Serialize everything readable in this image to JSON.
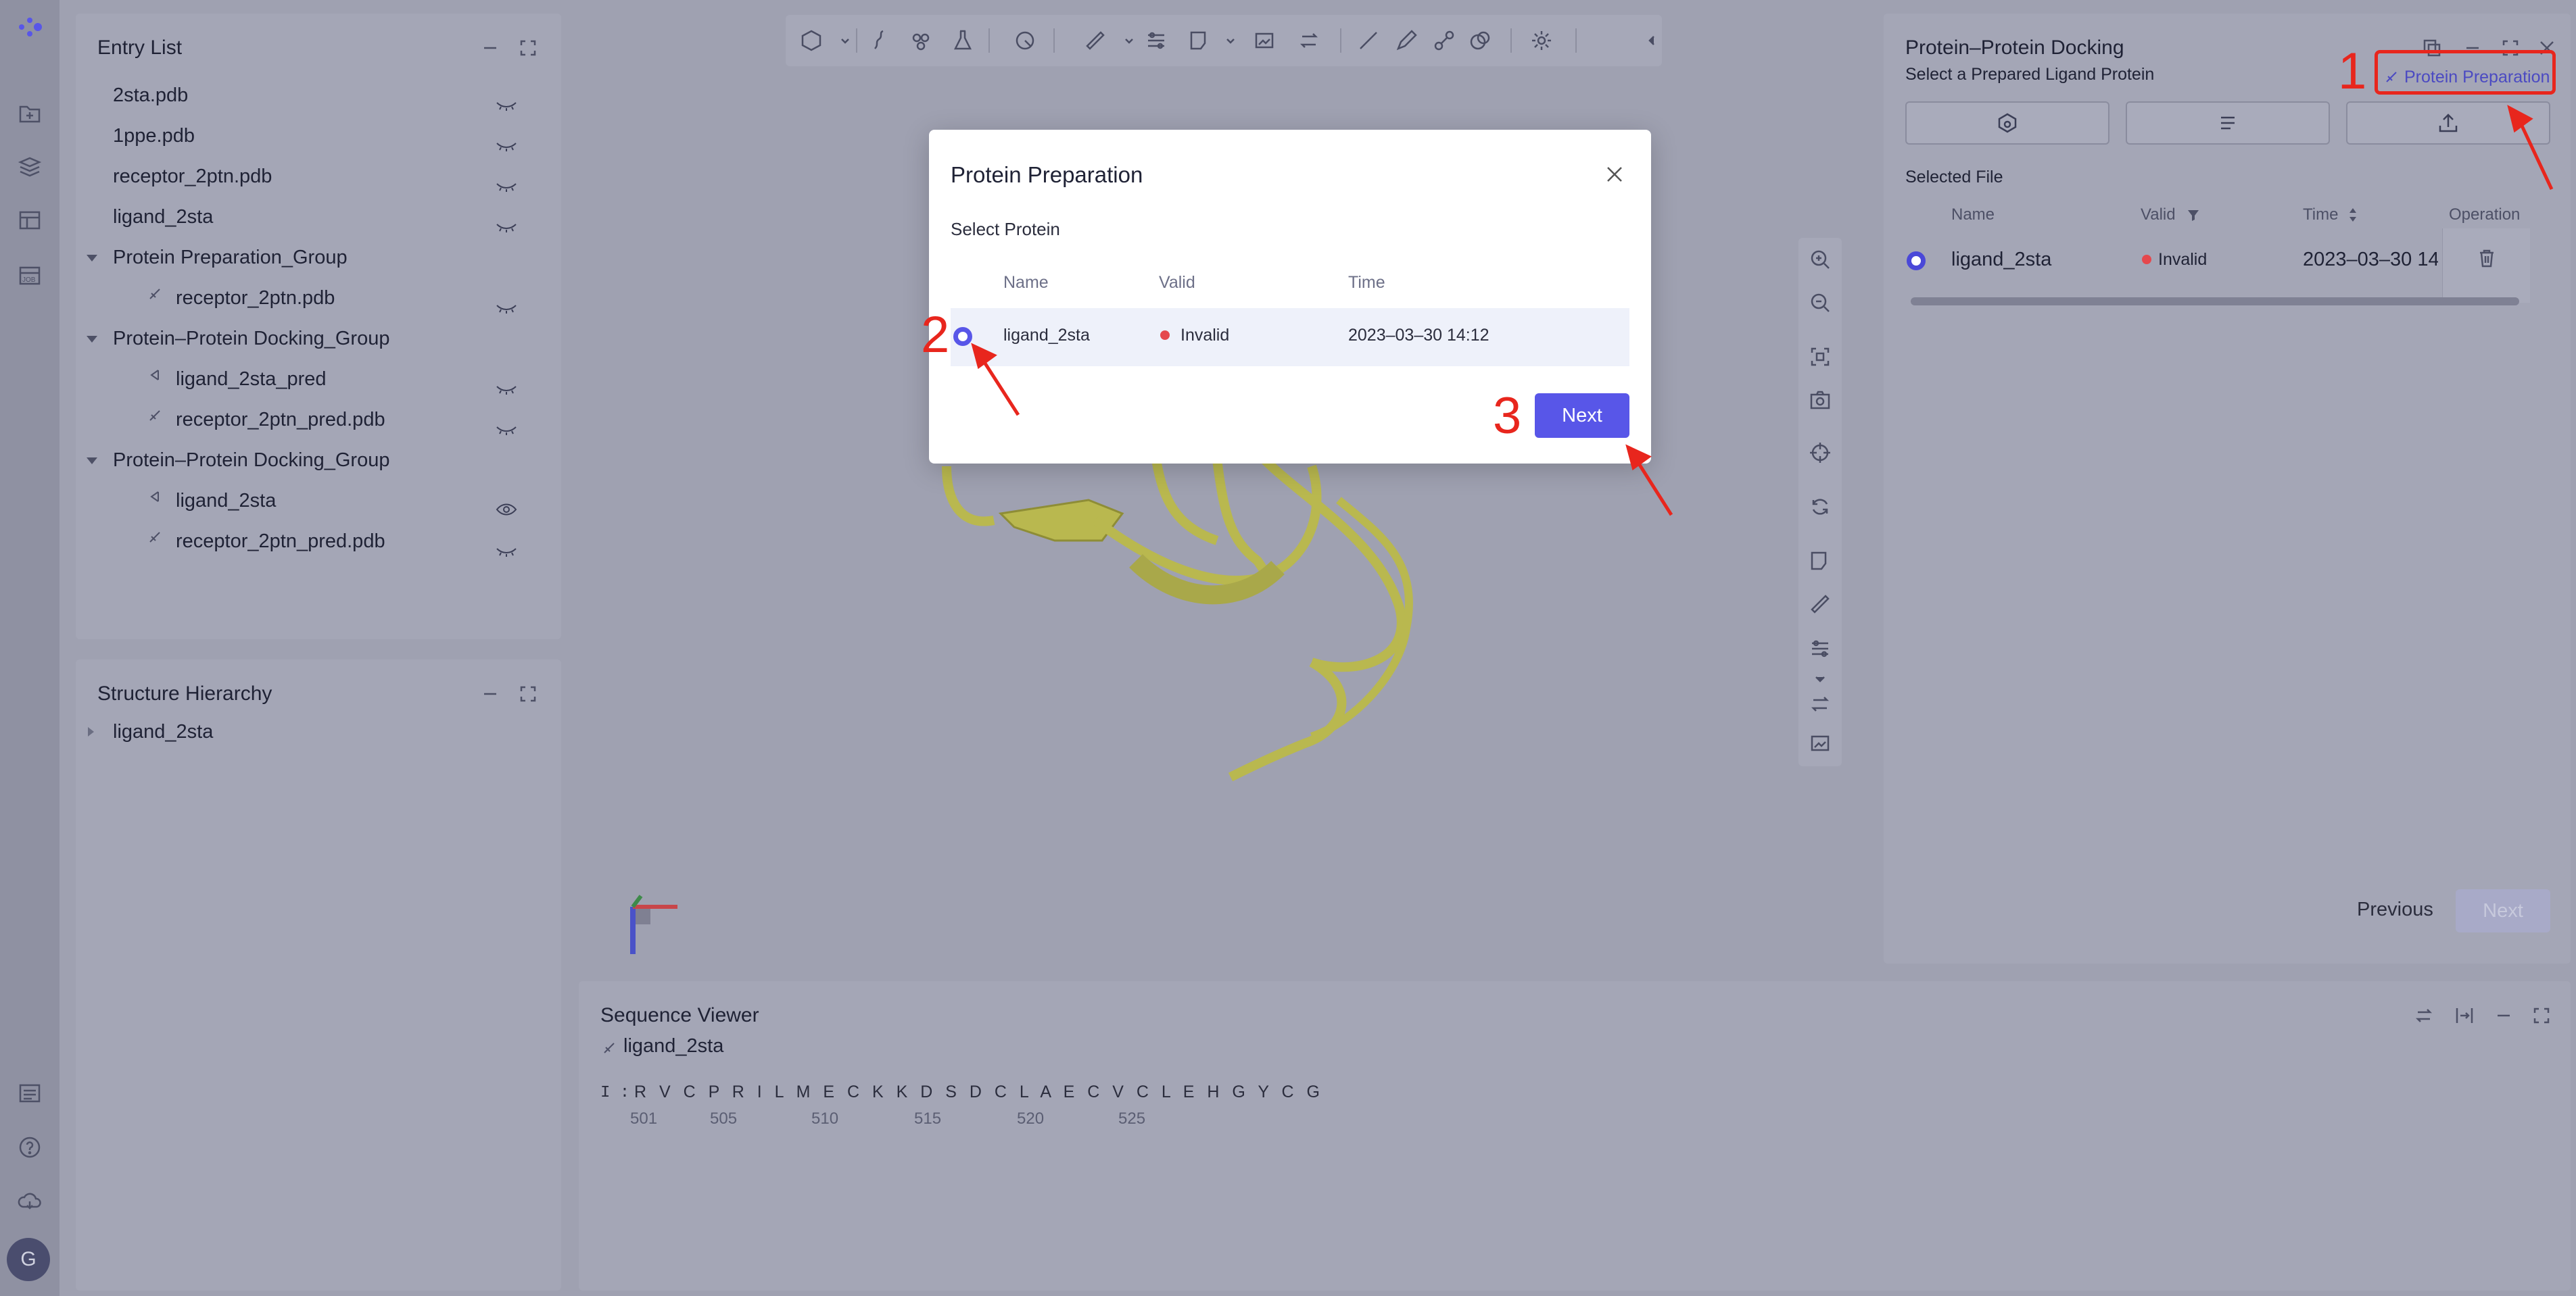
{
  "entry_list": {
    "title": "Entry List",
    "items": [
      {
        "label": "2sta.pdb"
      },
      {
        "label": "1ppe.pdb"
      },
      {
        "label": "receptor_2ptn.pdb"
      },
      {
        "label": "ligand_2sta"
      },
      {
        "label": "Protein Preparation_Group"
      },
      {
        "label": "receptor_2ptn.pdb"
      },
      {
        "label": "Protein–Protein Docking_Group"
      },
      {
        "label": "ligand_2sta_pred"
      },
      {
        "label": "receptor_2ptn_pred.pdb"
      },
      {
        "label": "Protein–Protein Docking_Group"
      },
      {
        "label": "ligand_2sta"
      },
      {
        "label": "receptor_2ptn_pred.pdb"
      }
    ]
  },
  "structure_hierarchy": {
    "title": "Structure Hierarchy",
    "items": [
      {
        "label": "ligand_2sta"
      }
    ]
  },
  "docking_panel": {
    "title": "Protein–Protein Docking",
    "subtitle": "Select a Prepared Ligand Protein",
    "prep_link": "Protein Preparation",
    "selected_file_label": "Selected File",
    "columns": {
      "name": "Name",
      "valid": "Valid",
      "time": "Time",
      "operation": "Operation"
    },
    "row": {
      "name": "ligand_2sta",
      "valid": "Invalid",
      "time": "2023–03–30 14"
    },
    "previous": "Previous",
    "next": "Next"
  },
  "sequence_viewer": {
    "title": "Sequence Viewer",
    "entry": "ligand_2sta",
    "chain": "I :",
    "residues": "R V C P R I L M E C K K D S D C L A E C V C L E H G Y C G",
    "positions": [
      "501",
      "505",
      "510",
      "515",
      "520",
      "525"
    ]
  },
  "modal": {
    "title": "Protein Preparation",
    "subtitle": "Select Protein",
    "columns": {
      "name": "Name",
      "valid": "Valid",
      "time": "Time"
    },
    "row": {
      "name": "ligand_2sta",
      "valid": "Invalid",
      "time": "2023–03–30 14:12"
    },
    "next": "Next"
  },
  "annotations": {
    "one": "1",
    "two": "2",
    "three": "3"
  },
  "user": {
    "initial": "G"
  },
  "colors": {
    "accent": "#5856e8",
    "invalid": "#e5484d",
    "annotation": "#e8261d",
    "protein": "#b9b84f"
  }
}
